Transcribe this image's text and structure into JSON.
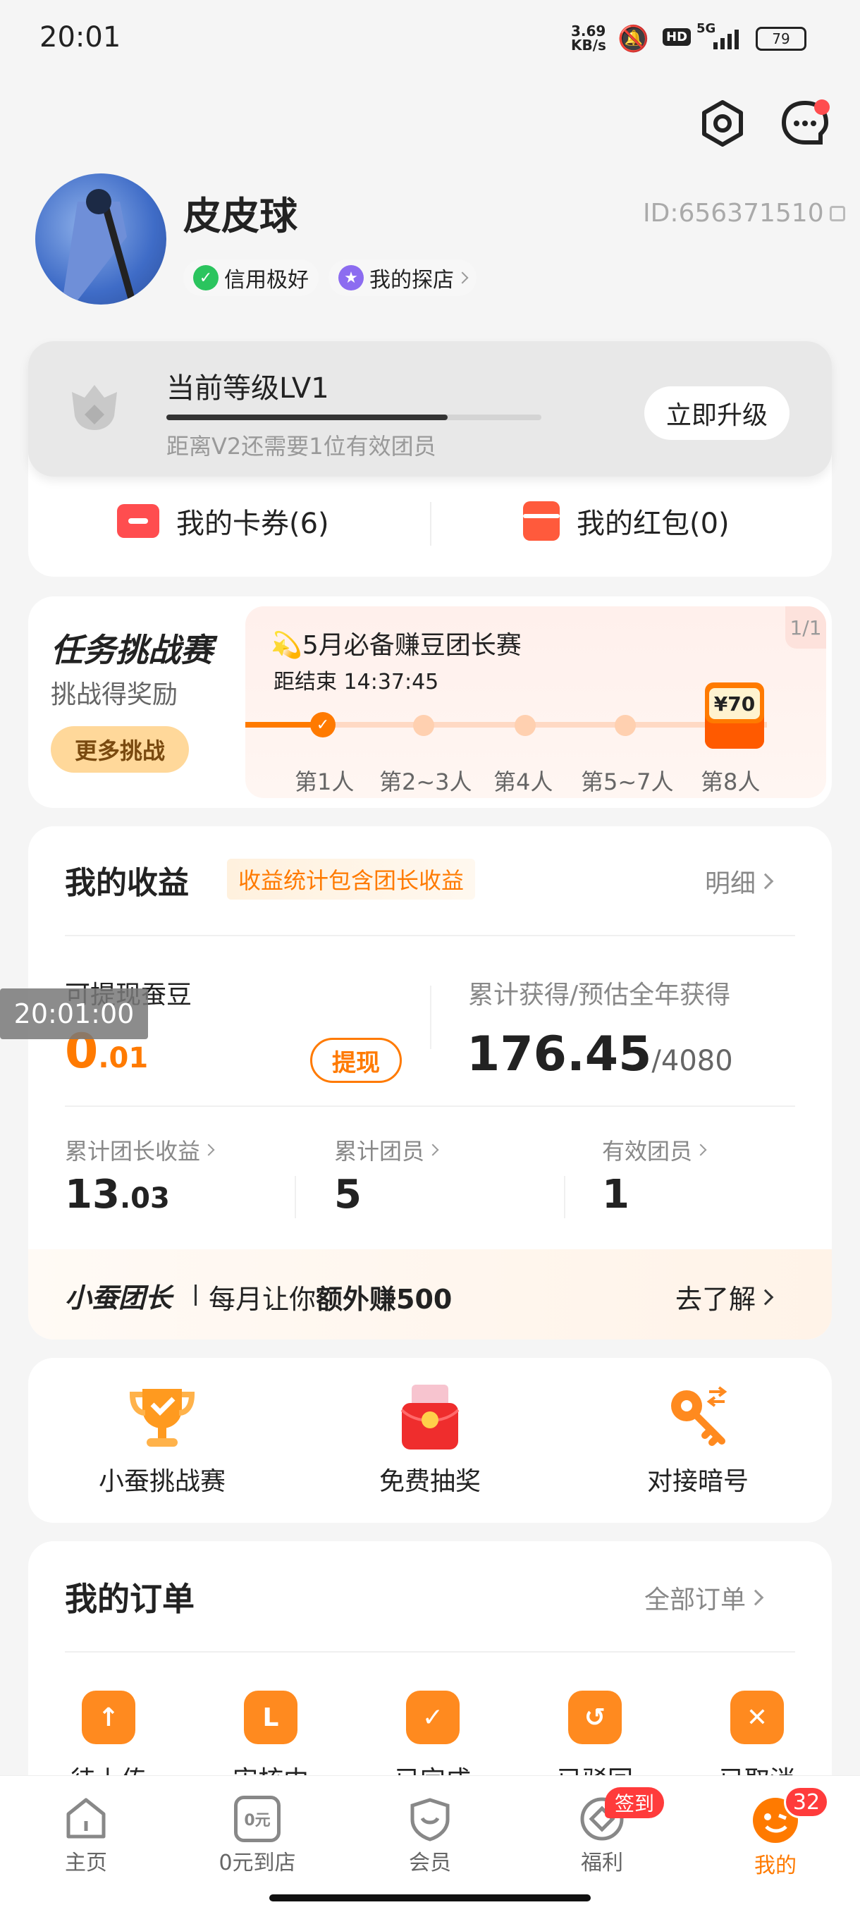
{
  "status_bar": {
    "time": "20:01",
    "net_speed": "3.69\nKB/s",
    "hd": "HD",
    "signal": "5G",
    "battery": "79"
  },
  "profile": {
    "name": "皮皮球",
    "id_text": "ID:656371510",
    "badge_credit": "信用极好",
    "badge_shop": "我的探店"
  },
  "level": {
    "title": "当前等级LV1",
    "progress": 0.75,
    "subtitle": "距离V2还需要1位有效团员",
    "upgrade_label": "立即升级"
  },
  "coupons": {
    "cards_label": "我的卡券(6)",
    "redpacket_label": "我的红包(0)"
  },
  "challenge": {
    "title": "任务挑战赛",
    "subtitle": "挑战得奖励",
    "more_label": "更多挑战",
    "event_title": "💫5月必备赚豆团长赛",
    "countdown": "距结束 14:37:45",
    "page_indicator": "1/1",
    "reward": "¥70",
    "steps": [
      "第1人",
      "第2~3人",
      "第4人",
      "第5~7人",
      "第8人"
    ]
  },
  "earnings": {
    "title": "我的收益",
    "tag": "收益统计包含团长收益",
    "detail_label": "明细",
    "withdrawable_label": "可提现蚕豆",
    "withdrawable_int": "0",
    "withdrawable_dec": ".01",
    "withdraw_btn": "提现",
    "total_label": "累计获得/预估全年获得",
    "total_value": "176.45",
    "total_year": "/4080",
    "stats": [
      {
        "label": "累计团长收益",
        "int": "13",
        "dec": ".03"
      },
      {
        "label": "累计团员",
        "int": "5",
        "dec": ""
      },
      {
        "label": "有效团员",
        "int": "1",
        "dec": ""
      }
    ],
    "promo_brand": "小蚕团长",
    "promo_text_pre": "每月让你",
    "promo_text_bold": "额外赚500",
    "promo_link": "去了解"
  },
  "overlay_time": "20:01:00",
  "features": [
    "小蚕挑战赛",
    "免费抽奖",
    "对接暗号"
  ],
  "orders": {
    "title": "我的订单",
    "all_label": "全部订单",
    "items": [
      "待上传",
      "审核中",
      "已完成",
      "已驳回",
      "已取消"
    ]
  },
  "tabbar": {
    "items": [
      "主页",
      "0元到店",
      "会员",
      "福利",
      "我的"
    ],
    "signin_badge": "签到",
    "msg_badge": "32",
    "zero_icon_text": "0元"
  },
  "colors": {
    "accent": "#ff7a00",
    "green": "#2bc45e",
    "purple": "#8c6cf0"
  }
}
